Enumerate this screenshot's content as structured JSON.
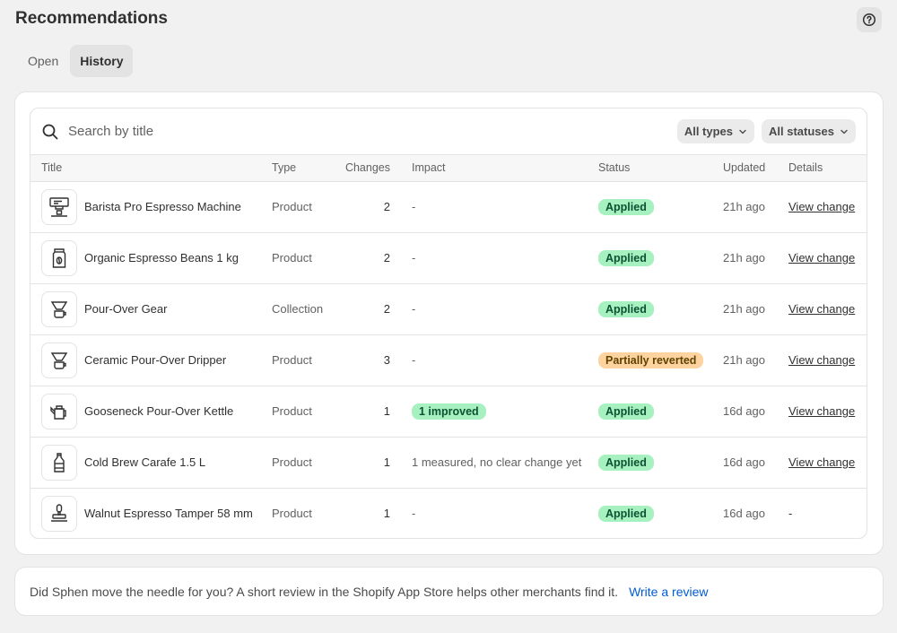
{
  "page": {
    "title": "Recommendations"
  },
  "tabs": [
    {
      "label": "Open"
    },
    {
      "label": "History"
    }
  ],
  "search": {
    "placeholder": "Search by title"
  },
  "filters": {
    "types": "All types",
    "statuses": "All statuses"
  },
  "table": {
    "headers": {
      "title": "Title",
      "type": "Type",
      "changes": "Changes",
      "impact": "Impact",
      "status": "Status",
      "updated": "Updated",
      "details": "Details"
    },
    "rows": [
      {
        "icon": "espresso-machine-icon",
        "title": "Barista Pro Espresso Machine",
        "type": "Product",
        "changes": "2",
        "impact": "-",
        "impact_badge": false,
        "status": "Applied",
        "status_tone": "success",
        "updated": "21h ago",
        "details": "View change",
        "details_link": true
      },
      {
        "icon": "coffee-bag-icon",
        "title": "Organic Espresso Beans 1 kg",
        "type": "Product",
        "changes": "2",
        "impact": "-",
        "impact_badge": false,
        "status": "Applied",
        "status_tone": "success",
        "updated": "21h ago",
        "details": "View change",
        "details_link": true
      },
      {
        "icon": "pour-over-icon",
        "title": "Pour-Over Gear",
        "type": "Collection",
        "changes": "2",
        "impact": "-",
        "impact_badge": false,
        "status": "Applied",
        "status_tone": "success",
        "updated": "21h ago",
        "details": "View change",
        "details_link": true
      },
      {
        "icon": "pour-over-icon",
        "title": "Ceramic Pour-Over Dripper",
        "type": "Product",
        "changes": "3",
        "impact": "-",
        "impact_badge": false,
        "status": "Partially reverted",
        "status_tone": "warning",
        "updated": "21h ago",
        "details": "View change",
        "details_link": true
      },
      {
        "icon": "kettle-icon",
        "title": "Gooseneck Pour-Over Kettle",
        "type": "Product",
        "changes": "1",
        "impact": "1 improved",
        "impact_badge": true,
        "status": "Applied",
        "status_tone": "success",
        "updated": "16d ago",
        "details": "View change",
        "details_link": true
      },
      {
        "icon": "bottle-icon",
        "title": "Cold Brew Carafe 1.5 L",
        "type": "Product",
        "changes": "1",
        "impact": "1 measured, no clear change yet",
        "impact_badge": false,
        "status": "Applied",
        "status_tone": "success",
        "updated": "16d ago",
        "details": "View change",
        "details_link": true
      },
      {
        "icon": "tamper-icon",
        "title": "Walnut Espresso Tamper 58 mm",
        "type": "Product",
        "changes": "1",
        "impact": "-",
        "impact_badge": false,
        "status": "Applied",
        "status_tone": "success",
        "updated": "16d ago",
        "details": "-",
        "details_link": false
      }
    ]
  },
  "footer": {
    "text": "Did Sphen move the needle for you? A short review in the Shopify App Store helps other merchants find it.",
    "link": "Write a review"
  },
  "colors": {
    "success_bg": "#a6f1bf",
    "warning_bg": "#fed3a0",
    "link": "#005bd3"
  }
}
